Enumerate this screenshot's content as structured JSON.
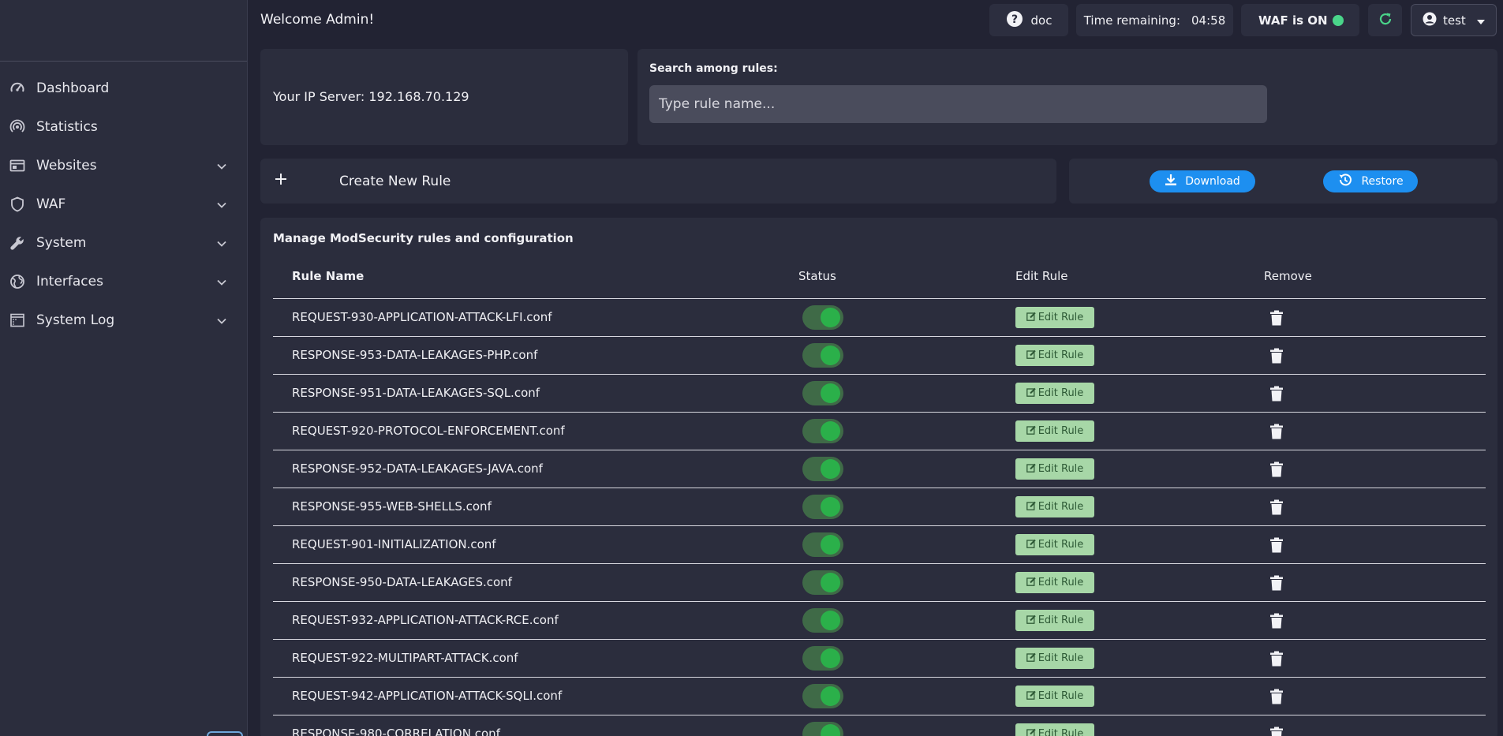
{
  "sidebar": {
    "items": [
      {
        "label": "Dashboard",
        "icon": "gauge-icon",
        "has_chevron": false
      },
      {
        "label": "Statistics",
        "icon": "broadcast-icon",
        "has_chevron": false
      },
      {
        "label": "Websites",
        "icon": "browser-window-icon",
        "has_chevron": true
      },
      {
        "label": "WAF",
        "icon": "shield-icon",
        "has_chevron": true
      },
      {
        "label": "System",
        "icon": "wrench-icon",
        "has_chevron": true
      },
      {
        "label": "Interfaces",
        "icon": "globe-icon",
        "has_chevron": true
      },
      {
        "label": "System Log",
        "icon": "log-calendar-icon",
        "has_chevron": true
      }
    ]
  },
  "header": {
    "welcome": "Welcome Admin!",
    "doc_label": "doc",
    "time_label": "Time remaining:",
    "time_value": "04:58",
    "waf_status": "WAF is ON",
    "waf_status_color": "#4ad58a",
    "user_name": "test"
  },
  "ip": {
    "text": "Your IP Server: 192.168.70.129"
  },
  "search": {
    "label": "Search among rules:",
    "placeholder": "Type rule name...",
    "value": ""
  },
  "actions": {
    "create_label": "Create New Rule",
    "download_label": "Download",
    "restore_label": "Restore",
    "accent": "#1d8ff0"
  },
  "table": {
    "title": "Manage ModSecurity rules and configuration",
    "columns": [
      "Rule Name",
      "Status",
      "Edit Rule",
      "Remove"
    ],
    "edit_label": "Edit Rule",
    "rows": [
      {
        "name": "REQUEST-930-APPLICATION-ATTACK-LFI.conf",
        "enabled": true
      },
      {
        "name": "RESPONSE-953-DATA-LEAKAGES-PHP.conf",
        "enabled": true
      },
      {
        "name": "RESPONSE-951-DATA-LEAKAGES-SQL.conf",
        "enabled": true
      },
      {
        "name": "REQUEST-920-PROTOCOL-ENFORCEMENT.conf",
        "enabled": true
      },
      {
        "name": "RESPONSE-952-DATA-LEAKAGES-JAVA.conf",
        "enabled": true
      },
      {
        "name": "RESPONSE-955-WEB-SHELLS.conf",
        "enabled": true
      },
      {
        "name": "REQUEST-901-INITIALIZATION.conf",
        "enabled": true
      },
      {
        "name": "RESPONSE-950-DATA-LEAKAGES.conf",
        "enabled": true
      },
      {
        "name": "REQUEST-932-APPLICATION-ATTACK-RCE.conf",
        "enabled": true
      },
      {
        "name": "REQUEST-922-MULTIPART-ATTACK.conf",
        "enabled": true
      },
      {
        "name": "REQUEST-942-APPLICATION-ATTACK-SQLI.conf",
        "enabled": true
      },
      {
        "name": "RESPONSE-980-CORRELATION.conf",
        "enabled": true
      }
    ]
  }
}
